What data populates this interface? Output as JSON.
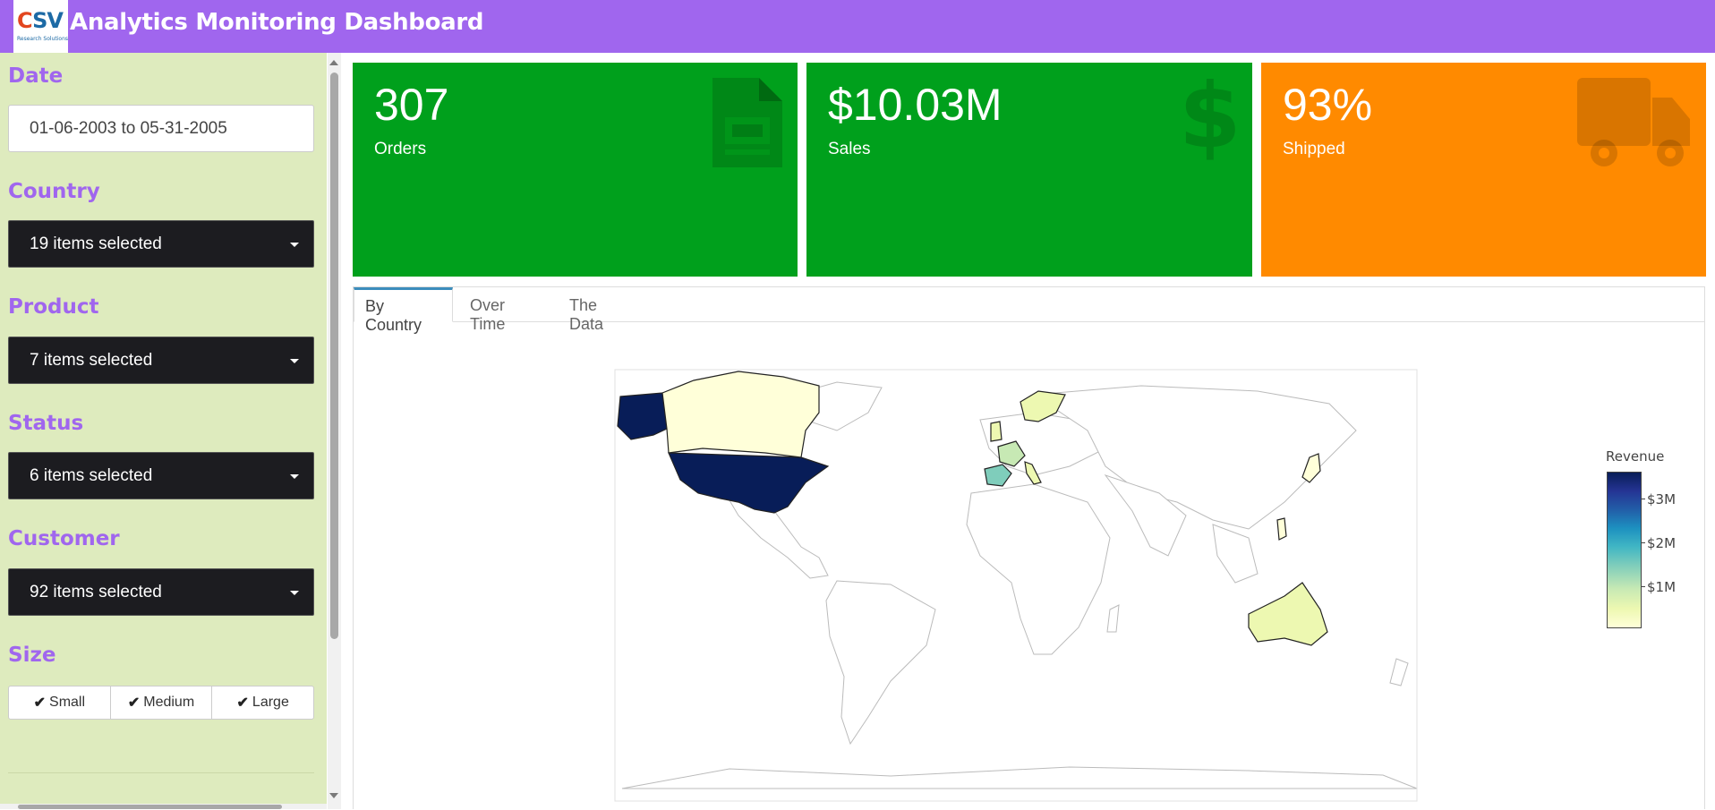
{
  "header": {
    "title": "Analytics Monitoring Dashboard",
    "logo_text": "CSV",
    "logo_subtext": "Research Solutions"
  },
  "filters": {
    "date": {
      "label": "Date",
      "value": "01-06-2003 to 05-31-2005"
    },
    "country": {
      "label": "Country",
      "value": "19 items selected"
    },
    "product": {
      "label": "Product",
      "value": "7 items selected"
    },
    "status": {
      "label": "Status",
      "value": "6 items selected"
    },
    "customer": {
      "label": "Customer",
      "value": "92 items selected"
    },
    "size": {
      "label": "Size",
      "options": [
        "Small",
        "Medium",
        "Large"
      ],
      "selected": [
        "Small",
        "Medium",
        "Large"
      ]
    }
  },
  "value_boxes": [
    {
      "value": "307",
      "label": "Orders",
      "color": "#00a01c",
      "icon": "file-text-icon"
    },
    {
      "value": "$10.03M",
      "label": "Sales",
      "color": "#00a01c",
      "icon": "dollar-icon"
    },
    {
      "value": "93%",
      "label": "Shipped",
      "color": "#ff8a00",
      "icon": "truck-icon"
    }
  ],
  "tabs": {
    "items": [
      "By Country",
      "Over Time",
      "The Data"
    ],
    "active": "By Country"
  },
  "map": {
    "legend_title": "Revenue",
    "colorbar_ticks": [
      "$3M",
      "$2M",
      "$1M"
    ],
    "colorscale": [
      "#ffffd9",
      "#edf8b1",
      "#c7e9b4",
      "#7fcdbb",
      "#41b6c4",
      "#1d91c0",
      "#225ea8",
      "#253494",
      "#081d58"
    ]
  },
  "colors": {
    "header": "#a066ee",
    "sidebar": "#deebbe",
    "accent_label": "#a066ee",
    "select_bg": "#1c1c20",
    "tab_active_border": "#3c8dbc"
  }
}
